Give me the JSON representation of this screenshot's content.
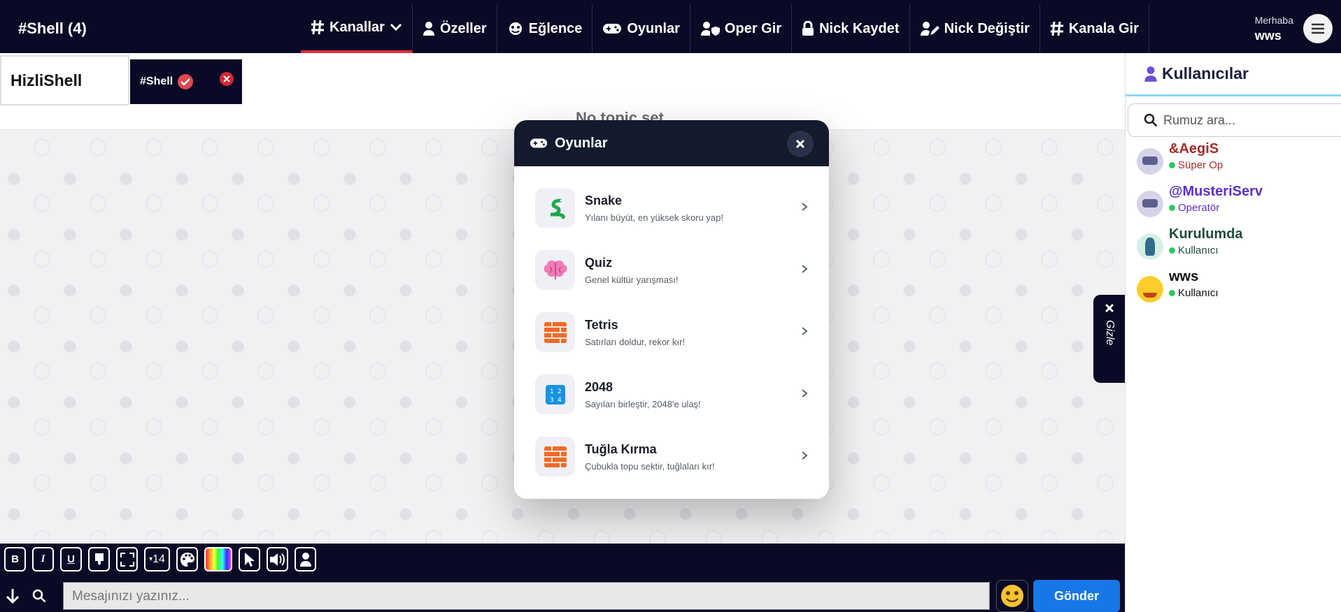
{
  "brand": "#Shell (4)",
  "nav": [
    {
      "label": "Kanallar",
      "icon": "hash-icon",
      "active": true,
      "dropdown": true
    },
    {
      "label": "Özeller",
      "icon": "user-icon"
    },
    {
      "label": "Eğlence",
      "icon": "mask-icon"
    },
    {
      "label": "Oyunlar",
      "icon": "gamepad-icon"
    },
    {
      "label": "Oper Gir",
      "icon": "user-shield-icon"
    },
    {
      "label": "Nick Kaydet",
      "icon": "lock-icon"
    },
    {
      "label": "Nick Değiştir",
      "icon": "user-pen-icon"
    },
    {
      "label": "Kanala Gir",
      "icon": "hash-icon"
    }
  ],
  "greeting": {
    "small": "Merhaba",
    "name": "wws"
  },
  "tabs": {
    "server": "HizliShell",
    "channel": "#Shell"
  },
  "topic": "No topic set",
  "hide_label": "Gizle",
  "modal": {
    "title": "Oyunlar",
    "games": [
      {
        "title": "Snake",
        "desc": "Yılanı büyüt, en yüksek skoru yap!",
        "icon": "snake-icon"
      },
      {
        "title": "Quiz",
        "desc": "Genel kültür yarışması!",
        "icon": "brain-icon"
      },
      {
        "title": "Tetris",
        "desc": "Satırları doldur, rekor kır!",
        "icon": "bricks-icon"
      },
      {
        "title": "2048",
        "desc": "Sayıları birleştir, 2048'e ulaş!",
        "icon": "numbers-icon"
      },
      {
        "title": "Tuğla Kırma",
        "desc": "Çubukla topu sektir, tuğlaları kır!",
        "icon": "bricks-icon"
      }
    ]
  },
  "sidebar": {
    "title": "Kullanıcılar",
    "search_placeholder": "Rumuz ara...",
    "users": [
      {
        "name": "&AegiS",
        "role": "Süper Op",
        "color": "#a52a2a"
      },
      {
        "name": "@MusteriServ",
        "role": "Operatör",
        "color": "#5a31c9"
      },
      {
        "name": "Kurulumda",
        "role": "Kullanıcı",
        "color": "#234a3c"
      },
      {
        "name": "wws",
        "role": "Kullanıcı",
        "color": "#111111"
      }
    ]
  },
  "toolbar": {
    "font_size": "14"
  },
  "input": {
    "placeholder": "Mesajınızı yazınız..."
  },
  "send_label": "Gönder"
}
